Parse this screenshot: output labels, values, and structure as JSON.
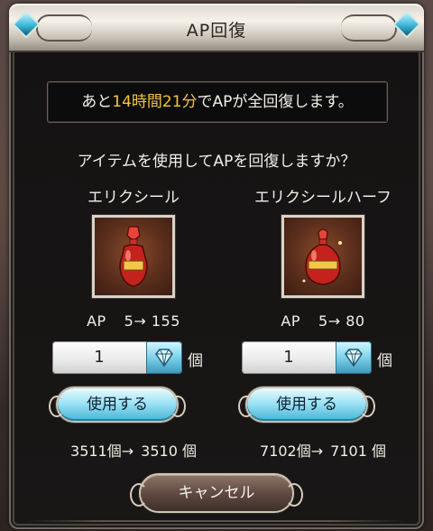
{
  "dialog": {
    "title": "AP回復",
    "message_prefix": "あと",
    "message_time": "14時間21分",
    "message_suffix": "でAPが全回復します。",
    "question": "アイテムを使用してAPを回復しますか？",
    "cancel_label": "キャンセル"
  },
  "items": [
    {
      "name": "エリクシール",
      "ap_label": "AP",
      "ap_from": "5",
      "ap_arrow": "→",
      "ap_to": "155",
      "quantity": "1",
      "unit": "個",
      "use_label": "使用する",
      "stock_before": "3511個→",
      "stock_after": "3510 個",
      "icon": "elixir-bottle-icon"
    },
    {
      "name": "エリクシールハーフ",
      "ap_label": "AP",
      "ap_from": "5",
      "ap_arrow": "→",
      "ap_to": "80",
      "quantity": "1",
      "unit": "個",
      "use_label": "使用する",
      "stock_before": "7102個→",
      "stock_after": "7101 個",
      "icon": "half-elixir-bottle-icon"
    }
  ],
  "colors": {
    "highlight": "#f0c540",
    "accent_blue": "#45b4d6",
    "cancel_brown": "#5d4740"
  }
}
